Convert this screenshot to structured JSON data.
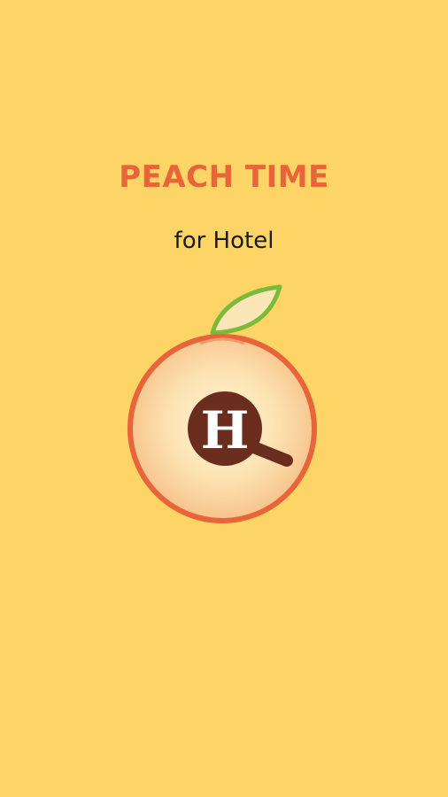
{
  "app": {
    "title": "PEACH TIME",
    "subtitle": "for Hotel",
    "logo_letter": "H",
    "logo_icon": "peach-magnifier-logo"
  },
  "colors": {
    "background": "#FDD466",
    "title": "#E8643A",
    "peach_ring": "#E8643A",
    "leaf_outline": "#7DBA3A",
    "magnifier": "#6B2E1E"
  }
}
